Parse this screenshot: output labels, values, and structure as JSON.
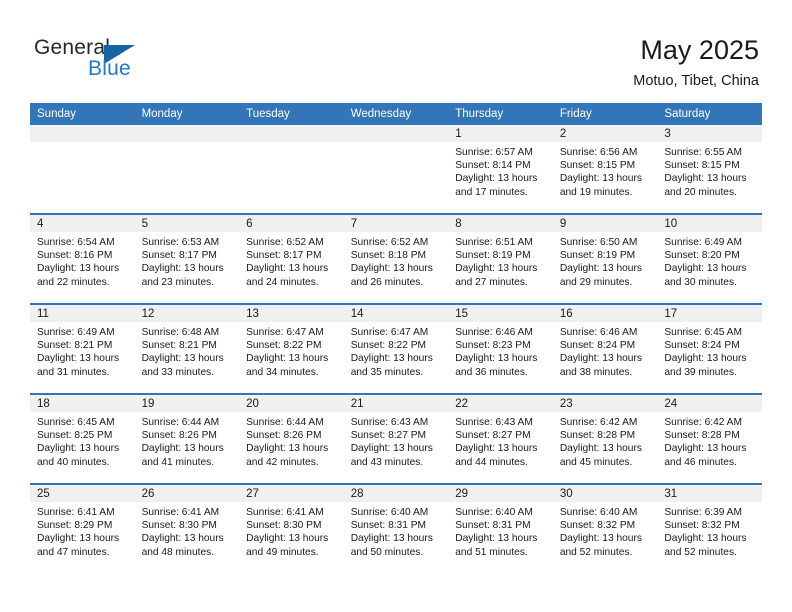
{
  "brand": {
    "word_general": "General",
    "word_blue": "Blue"
  },
  "header": {
    "title": "May 2025",
    "subtitle": "Motuo, Tibet, China"
  },
  "weekday_headers": [
    "Sunday",
    "Monday",
    "Tuesday",
    "Wednesday",
    "Thursday",
    "Friday",
    "Saturday"
  ],
  "colors": {
    "header_blue": "#3275b9",
    "brand_blue": "#2277c8",
    "triangle_blue": "#1464a5",
    "daynum_band": "#f0f0f0"
  },
  "weeks": [
    [
      {
        "day": "",
        "sunrise": "",
        "sunset": "",
        "daylight1": "",
        "daylight2": ""
      },
      {
        "day": "",
        "sunrise": "",
        "sunset": "",
        "daylight1": "",
        "daylight2": ""
      },
      {
        "day": "",
        "sunrise": "",
        "sunset": "",
        "daylight1": "",
        "daylight2": ""
      },
      {
        "day": "",
        "sunrise": "",
        "sunset": "",
        "daylight1": "",
        "daylight2": ""
      },
      {
        "day": "1",
        "sunrise": "Sunrise: 6:57 AM",
        "sunset": "Sunset: 8:14 PM",
        "daylight1": "Daylight: 13 hours",
        "daylight2": "and 17 minutes."
      },
      {
        "day": "2",
        "sunrise": "Sunrise: 6:56 AM",
        "sunset": "Sunset: 8:15 PM",
        "daylight1": "Daylight: 13 hours",
        "daylight2": "and 19 minutes."
      },
      {
        "day": "3",
        "sunrise": "Sunrise: 6:55 AM",
        "sunset": "Sunset: 8:15 PM",
        "daylight1": "Daylight: 13 hours",
        "daylight2": "and 20 minutes."
      }
    ],
    [
      {
        "day": "4",
        "sunrise": "Sunrise: 6:54 AM",
        "sunset": "Sunset: 8:16 PM",
        "daylight1": "Daylight: 13 hours",
        "daylight2": "and 22 minutes."
      },
      {
        "day": "5",
        "sunrise": "Sunrise: 6:53 AM",
        "sunset": "Sunset: 8:17 PM",
        "daylight1": "Daylight: 13 hours",
        "daylight2": "and 23 minutes."
      },
      {
        "day": "6",
        "sunrise": "Sunrise: 6:52 AM",
        "sunset": "Sunset: 8:17 PM",
        "daylight1": "Daylight: 13 hours",
        "daylight2": "and 24 minutes."
      },
      {
        "day": "7",
        "sunrise": "Sunrise: 6:52 AM",
        "sunset": "Sunset: 8:18 PM",
        "daylight1": "Daylight: 13 hours",
        "daylight2": "and 26 minutes."
      },
      {
        "day": "8",
        "sunrise": "Sunrise: 6:51 AM",
        "sunset": "Sunset: 8:19 PM",
        "daylight1": "Daylight: 13 hours",
        "daylight2": "and 27 minutes."
      },
      {
        "day": "9",
        "sunrise": "Sunrise: 6:50 AM",
        "sunset": "Sunset: 8:19 PM",
        "daylight1": "Daylight: 13 hours",
        "daylight2": "and 29 minutes."
      },
      {
        "day": "10",
        "sunrise": "Sunrise: 6:49 AM",
        "sunset": "Sunset: 8:20 PM",
        "daylight1": "Daylight: 13 hours",
        "daylight2": "and 30 minutes."
      }
    ],
    [
      {
        "day": "11",
        "sunrise": "Sunrise: 6:49 AM",
        "sunset": "Sunset: 8:21 PM",
        "daylight1": "Daylight: 13 hours",
        "daylight2": "and 31 minutes."
      },
      {
        "day": "12",
        "sunrise": "Sunrise: 6:48 AM",
        "sunset": "Sunset: 8:21 PM",
        "daylight1": "Daylight: 13 hours",
        "daylight2": "and 33 minutes."
      },
      {
        "day": "13",
        "sunrise": "Sunrise: 6:47 AM",
        "sunset": "Sunset: 8:22 PM",
        "daylight1": "Daylight: 13 hours",
        "daylight2": "and 34 minutes."
      },
      {
        "day": "14",
        "sunrise": "Sunrise: 6:47 AM",
        "sunset": "Sunset: 8:22 PM",
        "daylight1": "Daylight: 13 hours",
        "daylight2": "and 35 minutes."
      },
      {
        "day": "15",
        "sunrise": "Sunrise: 6:46 AM",
        "sunset": "Sunset: 8:23 PM",
        "daylight1": "Daylight: 13 hours",
        "daylight2": "and 36 minutes."
      },
      {
        "day": "16",
        "sunrise": "Sunrise: 6:46 AM",
        "sunset": "Sunset: 8:24 PM",
        "daylight1": "Daylight: 13 hours",
        "daylight2": "and 38 minutes."
      },
      {
        "day": "17",
        "sunrise": "Sunrise: 6:45 AM",
        "sunset": "Sunset: 8:24 PM",
        "daylight1": "Daylight: 13 hours",
        "daylight2": "and 39 minutes."
      }
    ],
    [
      {
        "day": "18",
        "sunrise": "Sunrise: 6:45 AM",
        "sunset": "Sunset: 8:25 PM",
        "daylight1": "Daylight: 13 hours",
        "daylight2": "and 40 minutes."
      },
      {
        "day": "19",
        "sunrise": "Sunrise: 6:44 AM",
        "sunset": "Sunset: 8:26 PM",
        "daylight1": "Daylight: 13 hours",
        "daylight2": "and 41 minutes."
      },
      {
        "day": "20",
        "sunrise": "Sunrise: 6:44 AM",
        "sunset": "Sunset: 8:26 PM",
        "daylight1": "Daylight: 13 hours",
        "daylight2": "and 42 minutes."
      },
      {
        "day": "21",
        "sunrise": "Sunrise: 6:43 AM",
        "sunset": "Sunset: 8:27 PM",
        "daylight1": "Daylight: 13 hours",
        "daylight2": "and 43 minutes."
      },
      {
        "day": "22",
        "sunrise": "Sunrise: 6:43 AM",
        "sunset": "Sunset: 8:27 PM",
        "daylight1": "Daylight: 13 hours",
        "daylight2": "and 44 minutes."
      },
      {
        "day": "23",
        "sunrise": "Sunrise: 6:42 AM",
        "sunset": "Sunset: 8:28 PM",
        "daylight1": "Daylight: 13 hours",
        "daylight2": "and 45 minutes."
      },
      {
        "day": "24",
        "sunrise": "Sunrise: 6:42 AM",
        "sunset": "Sunset: 8:28 PM",
        "daylight1": "Daylight: 13 hours",
        "daylight2": "and 46 minutes."
      }
    ],
    [
      {
        "day": "25",
        "sunrise": "Sunrise: 6:41 AM",
        "sunset": "Sunset: 8:29 PM",
        "daylight1": "Daylight: 13 hours",
        "daylight2": "and 47 minutes."
      },
      {
        "day": "26",
        "sunrise": "Sunrise: 6:41 AM",
        "sunset": "Sunset: 8:30 PM",
        "daylight1": "Daylight: 13 hours",
        "daylight2": "and 48 minutes."
      },
      {
        "day": "27",
        "sunrise": "Sunrise: 6:41 AM",
        "sunset": "Sunset: 8:30 PM",
        "daylight1": "Daylight: 13 hours",
        "daylight2": "and 49 minutes."
      },
      {
        "day": "28",
        "sunrise": "Sunrise: 6:40 AM",
        "sunset": "Sunset: 8:31 PM",
        "daylight1": "Daylight: 13 hours",
        "daylight2": "and 50 minutes."
      },
      {
        "day": "29",
        "sunrise": "Sunrise: 6:40 AM",
        "sunset": "Sunset: 8:31 PM",
        "daylight1": "Daylight: 13 hours",
        "daylight2": "and 51 minutes."
      },
      {
        "day": "30",
        "sunrise": "Sunrise: 6:40 AM",
        "sunset": "Sunset: 8:32 PM",
        "daylight1": "Daylight: 13 hours",
        "daylight2": "and 52 minutes."
      },
      {
        "day": "31",
        "sunrise": "Sunrise: 6:39 AM",
        "sunset": "Sunset: 8:32 PM",
        "daylight1": "Daylight: 13 hours",
        "daylight2": "and 52 minutes."
      }
    ]
  ]
}
